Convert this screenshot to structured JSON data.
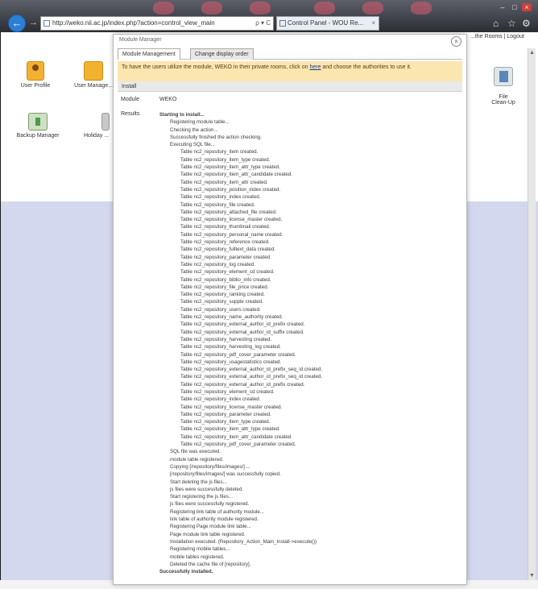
{
  "browser": {
    "address": "http://weko.nii.ac.jp/index.php?action=control_view_main",
    "tab_title": "Control Panel - WOU Re...",
    "tab_close": "×",
    "back_glyph": "←",
    "forward_glyph": "→",
    "addr_tools": "ρ ▾ C",
    "win_min": "–",
    "win_max": "□",
    "win_close": "×",
    "home_glyph": "⌂",
    "star_glyph": "☆",
    "gear_glyph": "⚙"
  },
  "page": {
    "top_links": "...the Rooms | Logout",
    "modules": [
      {
        "label": "User Profile"
      },
      {
        "label": "User Manage..."
      },
      {
        "label": "Backup Manager"
      },
      {
        "label": "Holiday ..."
      },
      {
        "label": "File\nClean-Up"
      }
    ],
    "scroll_up": "▲",
    "scroll_down": "▼"
  },
  "modal": {
    "title": "Module Manager",
    "close_glyph": "×",
    "tabs": [
      "Module Management",
      "Change display order"
    ],
    "notice_before": "To have the users utilize the module, WEKO in their private rooms, click on ",
    "notice_link": "here",
    "notice_after": " and choose the authorities to use it.",
    "install_label": "Install",
    "module_label": "Module",
    "module_value": "WEKO",
    "results_label": "Results"
  },
  "results": [
    {
      "level": 0,
      "text": "Starting to install..."
    },
    {
      "level": 1,
      "text": "Registering module table..."
    },
    {
      "level": 1,
      "text": "Checking the action..."
    },
    {
      "level": 1,
      "text": "Successfully finished the action checking."
    },
    {
      "level": 1,
      "text": "Executing SQL file..."
    },
    {
      "level": 2,
      "text": "Table nc2_repository_item created."
    },
    {
      "level": 2,
      "text": "Table nc2_repository_item_type created."
    },
    {
      "level": 2,
      "text": "Table nc2_repository_item_attr_type created."
    },
    {
      "level": 2,
      "text": "Table nc2_repository_item_attr_candidate created."
    },
    {
      "level": 2,
      "text": "Table nc2_repository_item_attr created."
    },
    {
      "level": 2,
      "text": "Table nc2_repository_position_index created."
    },
    {
      "level": 2,
      "text": "Table nc2_repository_index created."
    },
    {
      "level": 2,
      "text": "Table nc2_repository_file created."
    },
    {
      "level": 2,
      "text": "Table nc2_repository_attached_file created."
    },
    {
      "level": 2,
      "text": "Table nc2_repository_license_master created."
    },
    {
      "level": 2,
      "text": "Table nc2_repository_thumbnail created."
    },
    {
      "level": 2,
      "text": "Table nc2_repository_personal_name created."
    },
    {
      "level": 2,
      "text": "Table nc2_repository_reference created."
    },
    {
      "level": 2,
      "text": "Table nc2_repository_fulltext_data created."
    },
    {
      "level": 2,
      "text": "Table nc2_repository_parameter created."
    },
    {
      "level": 2,
      "text": "Table nc2_repository_log created."
    },
    {
      "level": 2,
      "text": "Table nc2_repository_element_cd created."
    },
    {
      "level": 2,
      "text": "Table nc2_repository_biblio_info created."
    },
    {
      "level": 2,
      "text": "Table nc2_repository_file_price created."
    },
    {
      "level": 2,
      "text": "Table nc2_repository_ranking created."
    },
    {
      "level": 2,
      "text": "Table nc2_repository_supple created."
    },
    {
      "level": 2,
      "text": "Table nc2_repository_users created."
    },
    {
      "level": 2,
      "text": "Table nc2_repository_name_authority created."
    },
    {
      "level": 2,
      "text": "Table nc2_repository_external_author_id_prefix created."
    },
    {
      "level": 2,
      "text": "Table nc2_repository_external_author_id_suffix created."
    },
    {
      "level": 2,
      "text": "Table nc2_repository_harvesting created."
    },
    {
      "level": 2,
      "text": "Table nc2_repository_harvesting_log created."
    },
    {
      "level": 2,
      "text": "Table nc2_repository_pdf_cover_parameter created."
    },
    {
      "level": 2,
      "text": "Table nc2_repository_usagestatistics created."
    },
    {
      "level": 2,
      "text": "Table nc2_repository_external_author_id_prefix_seq_id created."
    },
    {
      "level": 2,
      "text": "Table nc2_repository_external_author_id_prefix_seq_id created."
    },
    {
      "level": 2,
      "text": "Table nc2_repository_external_author_id_prefix created."
    },
    {
      "level": 2,
      "text": "Table nc2_repository_element_cd created."
    },
    {
      "level": 2,
      "text": "Table nc2_repository_index created."
    },
    {
      "level": 2,
      "text": "Table nc2_repository_license_master created."
    },
    {
      "level": 2,
      "text": "Table nc2_repository_parameter created."
    },
    {
      "level": 2,
      "text": "Table nc2_repository_item_type created."
    },
    {
      "level": 2,
      "text": "Table nc2_repository_item_attr_type created."
    },
    {
      "level": 2,
      "text": "Table nc2_repository_item_attr_candidate created."
    },
    {
      "level": 2,
      "text": "Table nc2_repository_pdf_cover_parameter created."
    },
    {
      "level": 1,
      "text": "SQL file was executed."
    },
    {
      "level": 1,
      "text": "module table registered."
    },
    {
      "level": 1,
      "text": "Copying [/repository/files/images/] ..."
    },
    {
      "level": 1,
      "text": "[/repository/files/images/] was successfully copied."
    },
    {
      "level": 1,
      "text": "Start deleting the js files..."
    },
    {
      "level": 1,
      "text": "js files were successfully deleted."
    },
    {
      "level": 1,
      "text": "Start registering the js files..."
    },
    {
      "level": 1,
      "text": "js files were successfully registered."
    },
    {
      "level": 1,
      "text": "Registering link table of authority module..."
    },
    {
      "level": 1,
      "text": "link table of authority module registered."
    },
    {
      "level": 1,
      "text": "Registering Page module link table..."
    },
    {
      "level": 1,
      "text": "Page module link table registered."
    },
    {
      "level": 1,
      "text": "Installation executed. (Repository_Action_Main_Install->execute())"
    },
    {
      "level": 1,
      "text": "Registering mobile tables..."
    },
    {
      "level": 1,
      "text": "mobile tables registered."
    },
    {
      "level": 1,
      "text": "Deleted the cache file of [repository]."
    },
    {
      "level": 0,
      "text": "Successfully installed."
    }
  ]
}
